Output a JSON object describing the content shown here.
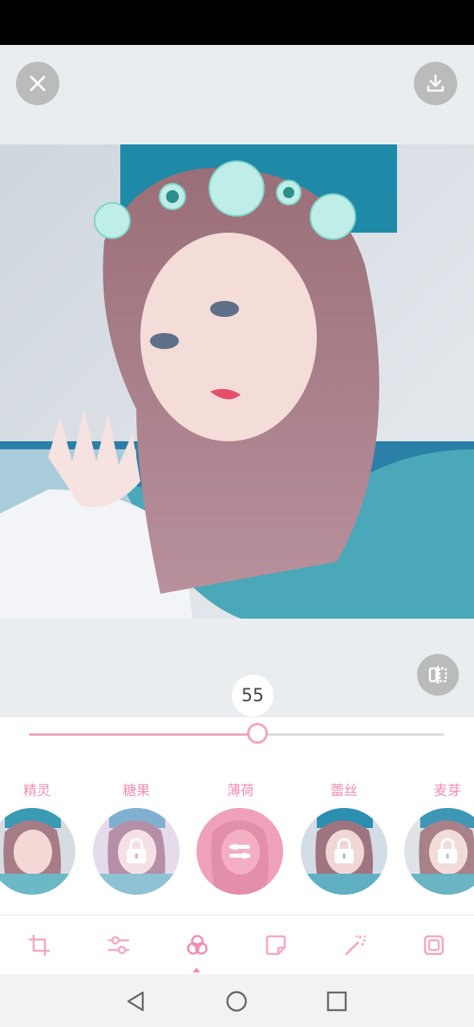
{
  "slider": {
    "value_label": "55",
    "value": 55,
    "min": 0,
    "max": 100
  },
  "filters": [
    {
      "label": "精灵",
      "locked": false,
      "selected": false
    },
    {
      "label": "糖果",
      "locked": true,
      "selected": false
    },
    {
      "label": "薄荷",
      "locked": false,
      "selected": true
    },
    {
      "label": "蕾丝",
      "locked": true,
      "selected": false
    },
    {
      "label": "麦芽",
      "locked": true,
      "selected": false
    }
  ],
  "toolbar": {
    "items": [
      "crop-icon",
      "adjust-icon",
      "filter-icon",
      "sticker-icon",
      "magic-wand-icon",
      "frame-icon"
    ],
    "active": "filter-icon"
  },
  "icons": {
    "close": "close-icon",
    "download": "download-icon",
    "compare": "compare-icon",
    "lock": "lock-icon"
  },
  "colors": {
    "accent": "#f08fb0",
    "editor_bg": "#e9edef",
    "button_bg": "#aaaaaa"
  }
}
